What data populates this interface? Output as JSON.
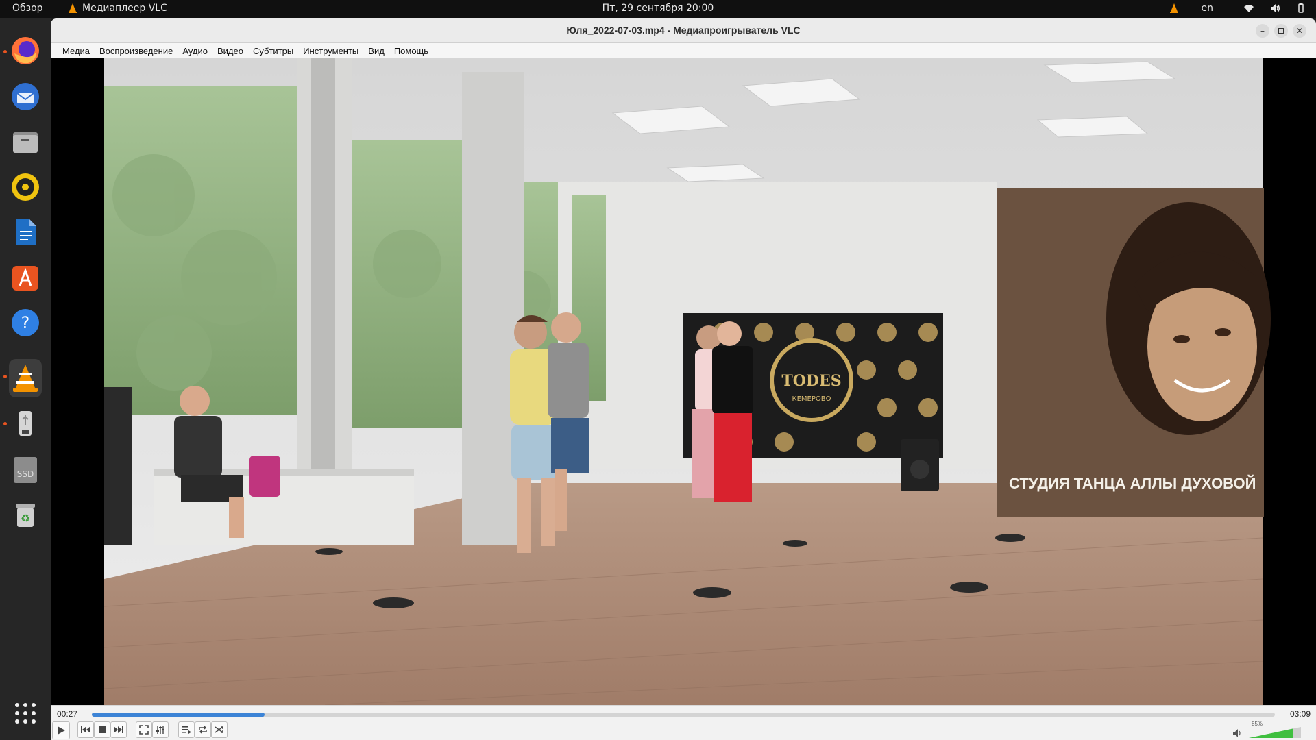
{
  "topbar": {
    "overview": "Обзор",
    "app_name": "Медиаплеер VLC",
    "clock": "Пт, 29 сентября  20:00",
    "lang": "en"
  },
  "dock": {
    "items": [
      "firefox-icon",
      "thunderbird-icon",
      "files-icon",
      "rhythmbox-icon",
      "writer-icon",
      "app-center-icon",
      "help-icon",
      "vlc-icon",
      "usb-drive-icon",
      "ssd-drive-icon",
      "trash-icon",
      "show-apps-icon"
    ],
    "ssd_label": "SSD"
  },
  "window": {
    "title": "Юля_2022-07-03.mp4 - Медиапроигрыватель VLC"
  },
  "menu": [
    "Медиа",
    "Воспроизведение",
    "Аудио",
    "Видео",
    "Субтитры",
    "Инструменты",
    "Вид",
    "Помощь"
  ],
  "video": {
    "banner_text": "СТУДИЯ ТАНЦА АЛЛЫ ДУХОВОЙ",
    "logo_text": "TODES",
    "logo_sub": "КЕМЕРОВО"
  },
  "controls": {
    "current_time": "00:27",
    "total_time": "03:09",
    "progress": 0.146,
    "volume_label": "85%",
    "volume": 0.85
  },
  "colors": {
    "accent": "#3d84d6",
    "ubuntu_orange": "#e95420"
  }
}
